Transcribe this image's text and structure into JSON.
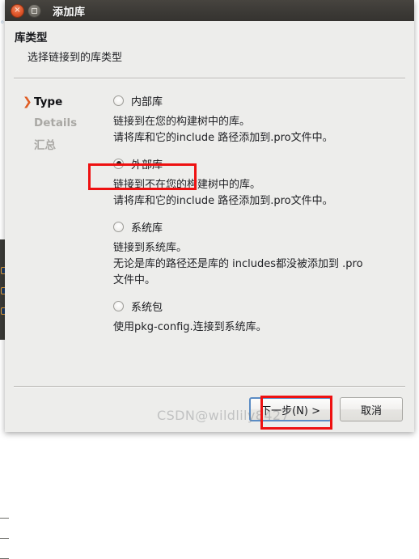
{
  "window": {
    "title": "添加库",
    "close_glyph": "×",
    "maximize_glyph": "□"
  },
  "header": {
    "title": "库类型",
    "subtitle": "选择链接到的库类型"
  },
  "steps": [
    {
      "label": "Type",
      "state": "active",
      "arrow": "❯"
    },
    {
      "label": "Details",
      "state": "inactive",
      "arrow": ""
    },
    {
      "label": "汇总",
      "state": "inactive",
      "arrow": ""
    }
  ],
  "options": [
    {
      "label": "内部库",
      "selected": false,
      "description_lines": [
        "链接到在您的构建树中的库。",
        "请将库和它的include 路径添加到.pro文件中。"
      ]
    },
    {
      "label": "外部库",
      "selected": true,
      "description_lines": [
        "链接到不在您的构建树中的库。",
        "请将库和它的include 路径添加到.pro文件中。"
      ]
    },
    {
      "label": "系统库",
      "selected": false,
      "description_lines": [
        "链接到系统库。",
        "无论是库的路径还是库的 includes都没被添加到 .pro",
        "文件中。"
      ]
    },
    {
      "label": "系统包",
      "selected": false,
      "description_lines": [
        "使用pkg-config.连接到系统库。"
      ]
    }
  ],
  "footer": {
    "next_label": "下一步(N) >",
    "cancel_label": "取消",
    "watermark": "CSDN@wildlily8427"
  },
  "colors": {
    "annotation_red": "#ee1111",
    "accent_orange": "#e05c22",
    "focus_blue": "#5b8cc4",
    "dialog_bg": "#ededeb",
    "titlebar_bg": "#3c3a36"
  }
}
